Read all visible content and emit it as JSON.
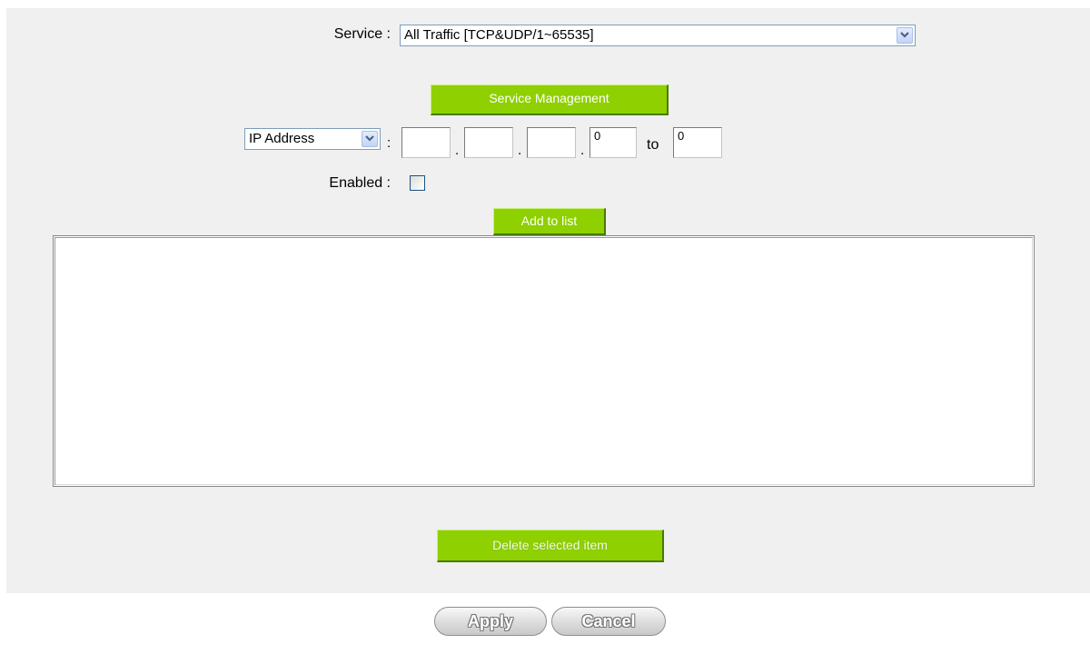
{
  "form": {
    "service_label": "Service :",
    "service_value": "All Traffic [TCP&UDP/1~65535]",
    "service_management_button": "Service Management",
    "address_type_value": "IP Address",
    "address_colon": ":",
    "ip_octet_1": "",
    "ip_octet_2": "",
    "ip_octet_3": "",
    "ip_octet_4": "0",
    "ip_separator": ".",
    "to_label": "to",
    "ip_range_end": "0",
    "enabled_label": "Enabled :",
    "enabled_checked": false,
    "add_to_list_button": "Add to list"
  },
  "list": {
    "items": []
  },
  "delete_button": "Delete selected item",
  "footer": {
    "apply_button": "Apply",
    "cancel_button": "Cancel"
  },
  "colors": {
    "panel_background": "#f0f0f0",
    "green_button": "#8fd000",
    "select_border": "#7f9db9"
  },
  "icons": {
    "dropdown_arrow": "chevron-down-icon"
  }
}
